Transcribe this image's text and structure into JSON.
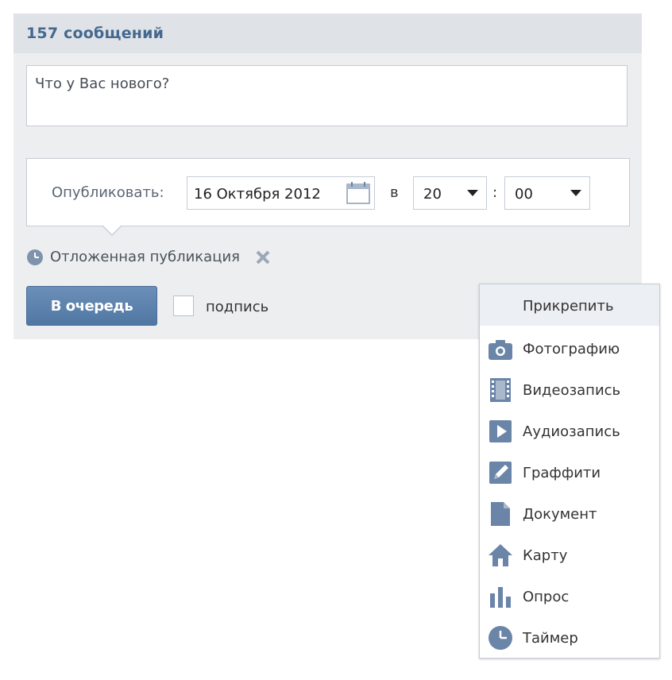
{
  "panel": {
    "title": "157 сообщений"
  },
  "composer": {
    "placeholder": "Что у Вас нового?"
  },
  "schedule": {
    "publish_label": "Опубликовать:",
    "date": "16 Октября 2012",
    "at_label": "в",
    "hour": "20",
    "colon": ":",
    "minute": "00"
  },
  "deferred": {
    "label": "Отложенная публикация"
  },
  "actions": {
    "queue_label": "В очередь",
    "sign_label": "подпись"
  },
  "attach_menu": {
    "title": "Прикрепить",
    "items": [
      {
        "label": "Фотографию",
        "icon": "camera-icon"
      },
      {
        "label": "Видеозапись",
        "icon": "film-icon"
      },
      {
        "label": "Аудиозапись",
        "icon": "play-icon"
      },
      {
        "label": "Граффити",
        "icon": "pencil-icon"
      },
      {
        "label": "Документ",
        "icon": "document-icon"
      },
      {
        "label": "Карту",
        "icon": "house-icon"
      },
      {
        "label": "Опрос",
        "icon": "bar-chart-icon"
      },
      {
        "label": "Таймер",
        "icon": "clock-icon"
      }
    ]
  },
  "colors": {
    "icon": "#6a85a8",
    "title": "#45688e",
    "button": "#5a7fab"
  }
}
